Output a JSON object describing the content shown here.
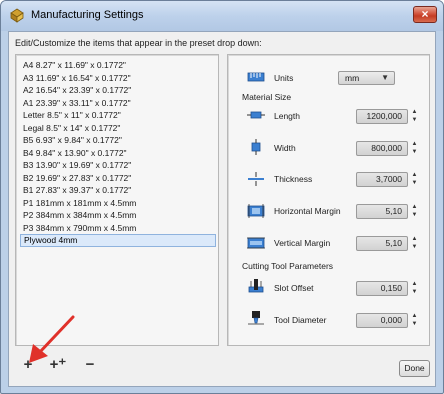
{
  "window": {
    "title": "Manufacturing Settings",
    "close_glyph": "×"
  },
  "caption": "Edit/Customize the items that appear in the preset drop down:",
  "presets": [
    "A4 8.27\" x 11.69\" x 0.1772\"",
    "A3 11.69\" x 16.54\" x 0.1772\"",
    "A2 16.54\" x 23.39\" x 0.1772\"",
    "A1 23.39\" x 33.11\" x 0.1772\"",
    "Letter 8.5\" x 11\" x 0.1772\"",
    "Legal 8.5\" x 14\" x 0.1772\"",
    "B5 6.93\" x 9.84\" x 0.1772\"",
    "B4 9.84\" x 13.90\" x 0.1772\"",
    "B3 13.90\" x 19.69\" x 0.1772\"",
    "B2 19.69\" x 27.83\" x 0.1772\"",
    "B1 27.83\" x 39.37\" x 0.1772\"",
    "P1 181mm x 181mm x 4.5mm",
    "P2 384mm x 384mm x 4.5mm",
    "P3 384mm x 790mm x 4.5mm",
    "Plywood 4mm"
  ],
  "selected_preset": "Plywood 4mm",
  "units": {
    "label": "Units",
    "value": "mm"
  },
  "material_size": {
    "title": "Material Size",
    "length": {
      "label": "Length",
      "value": "1200,000"
    },
    "width": {
      "label": "Width",
      "value": "800,000"
    },
    "thickness": {
      "label": "Thickness",
      "value": "3,7000"
    },
    "horizontal_margin": {
      "label": "Horizontal Margin",
      "value": "5,10"
    },
    "vertical_margin": {
      "label": "Vertical Margin",
      "value": "5,10"
    }
  },
  "cutting_tool": {
    "title": "Cutting Tool Parameters",
    "slot_offset": {
      "label": "Slot Offset",
      "value": "0,150"
    },
    "tool_diameter": {
      "label": "Tool Diameter",
      "value": "0,000"
    }
  },
  "buttons": {
    "add": "+",
    "add_copy": "+⁺",
    "remove": "−",
    "done": "Done"
  },
  "colors": {
    "accent_blue": "#2f74c0",
    "annotation_arrow": "#e0312a",
    "selection": "#dbe9fa"
  }
}
